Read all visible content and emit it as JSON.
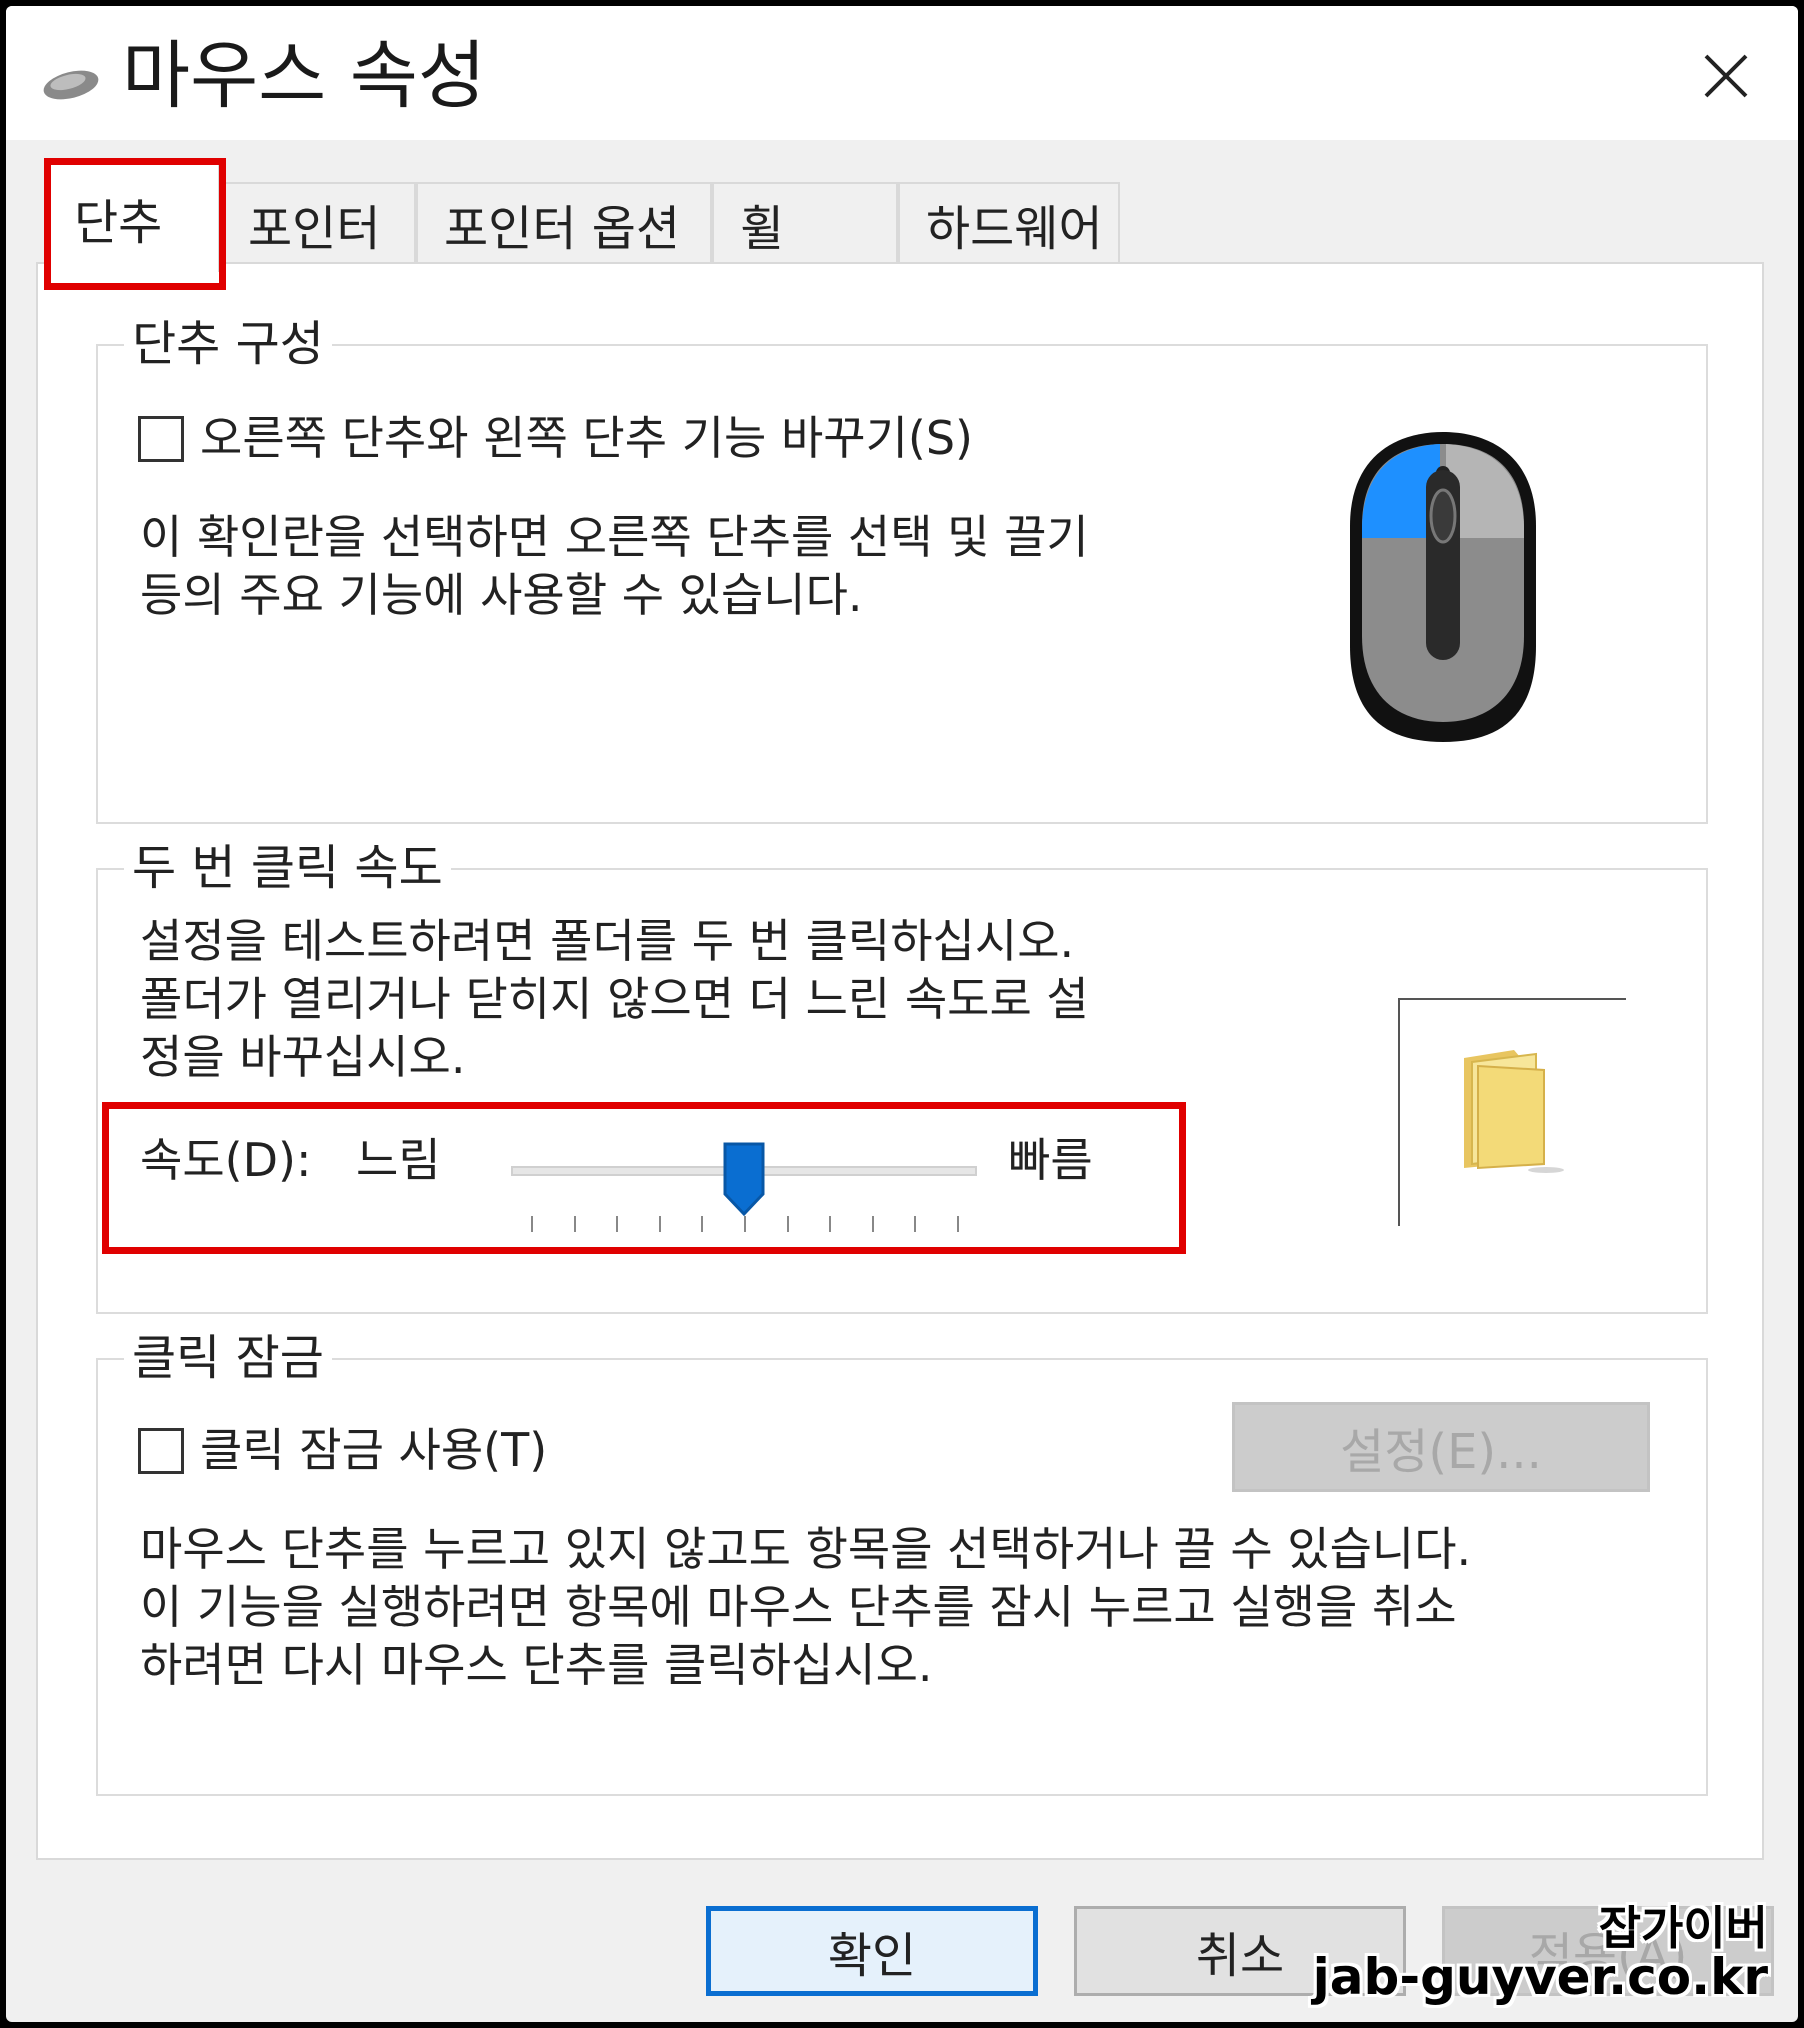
{
  "window": {
    "title": "마우스 속성"
  },
  "tabs": [
    {
      "label": "단추",
      "active": true
    },
    {
      "label": "포인터"
    },
    {
      "label": "포인터 옵션"
    },
    {
      "label": "휠"
    },
    {
      "label": "하드웨어"
    }
  ],
  "button_config": {
    "legend": "단추 구성",
    "swap_checkbox_label": "오른쪽 단추와 왼쪽 단추 기능 바꾸기(S)",
    "swap_checked": false,
    "description": [
      "이 확인란을 선택하면 오른쪽 단추를 선택 및 끌기",
      "등의 주요 기능에 사용할 수 있습니다."
    ]
  },
  "double_click": {
    "legend": "두 번 클릭 속도",
    "description": [
      "설정을 테스트하려면 폴더를 두 번 클릭하십시오.",
      "폴더가 열리거나 닫히지 않으면 더 느린 속도로 설",
      "정을 바꾸십시오."
    ],
    "speed_label": "속도(D):",
    "slow_label": "느림",
    "fast_label": "빠름",
    "speed_fraction": 0.5
  },
  "click_lock": {
    "legend": "클릭 잠금",
    "checkbox_label": "클릭 잠금 사용(T)",
    "checked": false,
    "settings_button": "설정(E)...",
    "description": [
      "마우스 단추를 누르고 있지 않고도 항목을 선택하거나 끌 수 있습니다.",
      "이 기능을 실행하려면 항목에 마우스 단추를 잠시 누르고 실행을 취소",
      "하려면 다시 마우스 단추를 클릭하십시오."
    ]
  },
  "footer": {
    "ok": "확인",
    "cancel": "취소",
    "apply": "적용(A)"
  },
  "watermark": {
    "name": "잡가이버",
    "url": "jab-guyver.co.kr"
  },
  "colors": {
    "highlight": "#e00000",
    "accent": "#0a6ed1",
    "mouse_button_active": "#1e90ff"
  },
  "icons": {
    "app": "mouse-icon",
    "close": "close-icon",
    "illustration": "mouse-illustration",
    "folder": "folder-icon"
  }
}
